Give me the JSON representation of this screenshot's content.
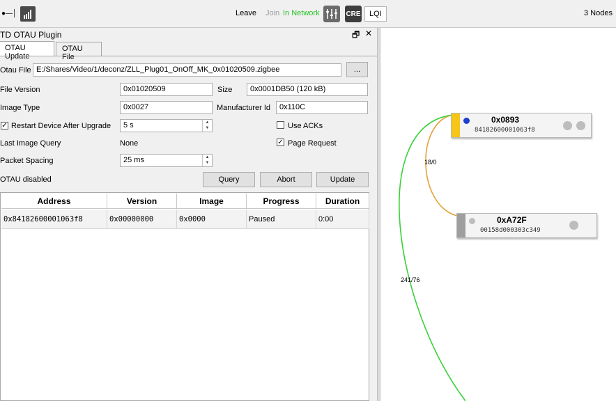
{
  "toolbar": {
    "leave": "Leave",
    "join": "Join",
    "in_network": "In Network",
    "cre": "CRE",
    "lqi": "LQI",
    "nodes_count": "3 Nodes",
    "colors": {
      "in_network": "#22c322",
      "join": "#9a9a9a"
    }
  },
  "panel": {
    "title": "TD OTAU Plugin",
    "tabs": [
      "OTAU Update",
      "OTAU File"
    ],
    "otau_file_label": "Otau File",
    "otau_file_value": "E:/Shares/Video/1/deconz/ZLL_Plug01_OnOff_MK_0x01020509.zigbee",
    "browse_label": "...",
    "file_version_label": "File Version",
    "file_version_value": "0x01020509",
    "size_label": "Size",
    "size_value": "0x0001DB50 (120 kB)",
    "image_type_label": "Image Type",
    "image_type_value": "0x0027",
    "manufacturer_label": "Manufacturer Id",
    "manufacturer_value": "0x110C",
    "restart_label": "Restart Device After Upgrade",
    "restart_checked": true,
    "restart_value": "5 s",
    "use_acks_label": "Use ACKs",
    "use_acks_checked": false,
    "last_query_label": "Last Image Query",
    "last_query_value": "None",
    "page_request_label": "Page Request",
    "page_request_checked": true,
    "packet_spacing_label": "Packet Spacing",
    "packet_spacing_value": "25 ms",
    "status": "OTAU disabled",
    "query_label": "Query",
    "abort_label": "Abort",
    "update_label": "Update"
  },
  "table": {
    "headers": [
      "Address",
      "Version",
      "Image",
      "Progress",
      "Duration"
    ],
    "rows": [
      [
        "0x84182600001063f8",
        "0x00000000",
        "0x0000",
        "Paused",
        "0:00"
      ]
    ]
  },
  "graph": {
    "nodes": [
      {
        "title": "0x0893",
        "subtitle": "84182600001063f8",
        "accent": "#f5c518"
      },
      {
        "title": "0xA72F",
        "subtitle": "00158d000303c349",
        "accent": "#9e9e9e"
      }
    ],
    "edges": [
      {
        "label": "18/0",
        "color": "#e3a23a"
      },
      {
        "label": "241/76",
        "color": "#3ad13a"
      }
    ]
  }
}
